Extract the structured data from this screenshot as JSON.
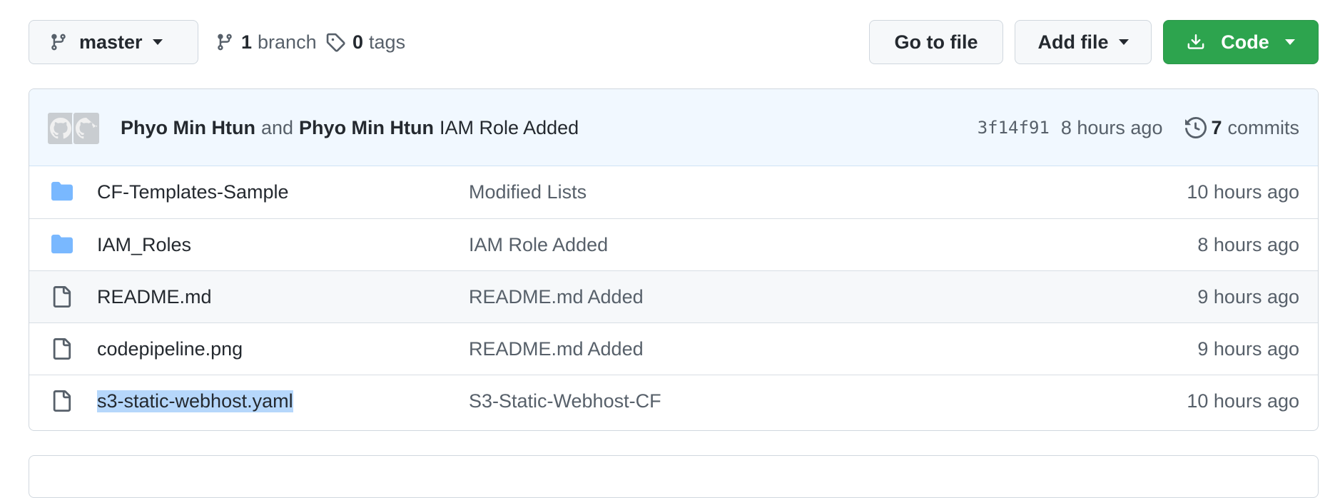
{
  "toolbar": {
    "branch_label": "master",
    "branch_count": "1",
    "branch_word": "branch",
    "tag_count": "0",
    "tag_word": "tags",
    "goto_label": "Go to file",
    "add_label": "Add file",
    "code_label": "Code"
  },
  "commit": {
    "author1": "Phyo Min Htun",
    "and_word": "and",
    "author2": "Phyo Min Htun",
    "message": "IAM Role Added",
    "sha": "3f14f91",
    "time": "8 hours ago",
    "commit_count": "7",
    "commit_word": "commits"
  },
  "files": [
    {
      "name": "CF-Templates-Sample",
      "message": "Modified Lists",
      "time": "10 hours ago",
      "icon": "folder-icon"
    },
    {
      "name": "IAM_Roles",
      "message": "IAM Role Added",
      "time": "8 hours ago",
      "icon": "folder-icon"
    },
    {
      "name": "README.md",
      "message": "README.md Added",
      "time": "9 hours ago",
      "icon": "file-icon"
    },
    {
      "name": "codepipeline.png",
      "message": "README.md Added",
      "time": "9 hours ago",
      "icon": "file-icon"
    },
    {
      "name": "s3-static-webhost.yaml",
      "message": "S3-Static-Webhost-CF",
      "time": "10 hours ago",
      "icon": "file-icon"
    }
  ],
  "colors": {
    "accent_green": "#2da44e",
    "folder_blue": "#79b8ff",
    "commit_bg": "#f1f8ff",
    "selection": "#b6d7fb"
  }
}
